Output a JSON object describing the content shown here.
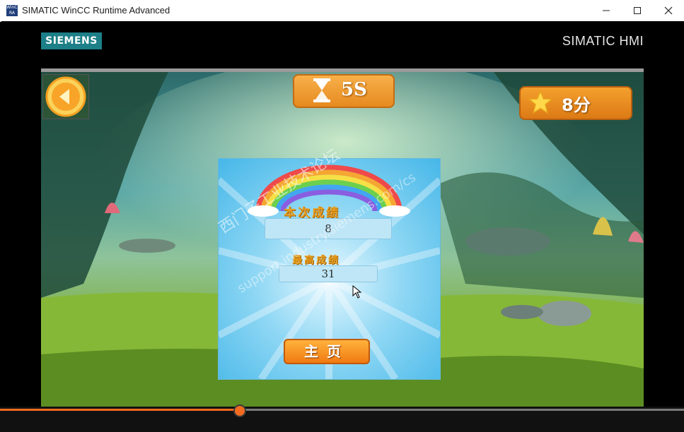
{
  "window": {
    "title": "SIMATIC WinCC Runtime Advanced",
    "icon_text": "WinCC RA"
  },
  "header": {
    "brand_logo": "SIEMENS",
    "product": "SIMATIC HMI"
  },
  "game": {
    "back_icon": "back-arrow-icon",
    "timer_icon": "hourglass-icon",
    "timer": "5S",
    "score_icon": "star-icon",
    "score": "8分"
  },
  "result_panel": {
    "current_label": "本次成绩",
    "current_value": "8",
    "best_label": "最高成绩",
    "best_value": "31",
    "home_button": "主页"
  },
  "watermark": {
    "line1": "西门子工业技术论坛",
    "line2": "support.industry.siemens.com/cs"
  },
  "video": {
    "progress": 0.35
  },
  "colors": {
    "accent": "#f26b21",
    "siemens_teal": "#1d7f87",
    "panel_blue": "#46b7e8",
    "button_orange": "#f07a12"
  }
}
